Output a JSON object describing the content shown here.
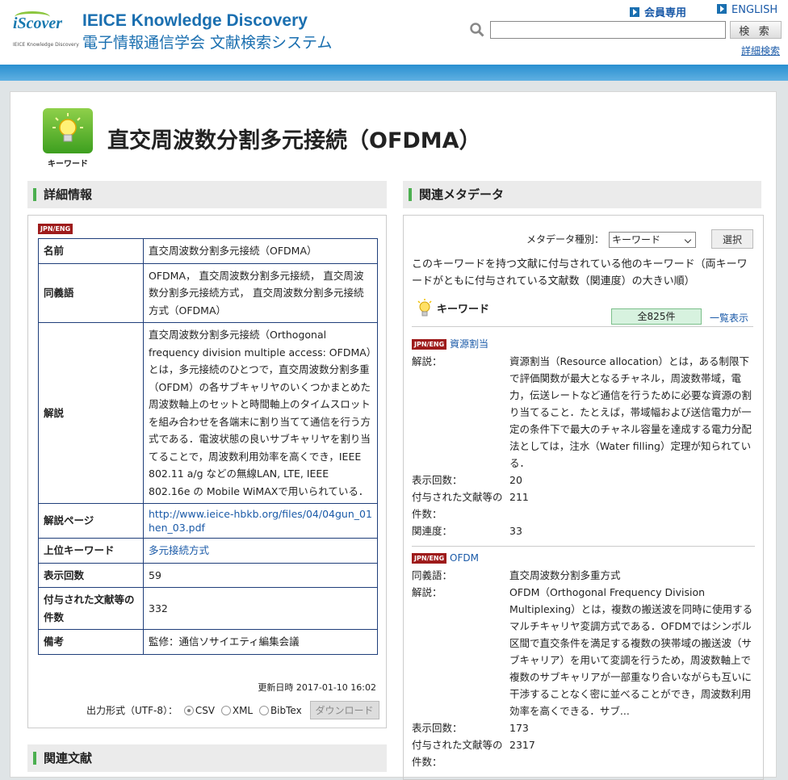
{
  "header": {
    "brand_title": "IEICE Knowledge Discovery",
    "brand_sub": "電子情報通信学会 文献検索システム",
    "logo_text": "iScover",
    "logo_sub": "IEICE Knowledge Discovery",
    "member_link": "会員専用",
    "english_link": "ENGLISH",
    "search_button": "検 索",
    "advanced_search": "詳細検索"
  },
  "page": {
    "icon_caption": "キーワード",
    "title": "直交周波数分割多元接続（OFDMA）"
  },
  "detail": {
    "heading": "詳細情報",
    "badge": "JPN/ENG",
    "rows": [
      {
        "k": "名前",
        "v": "直交周波数分割多元接続（OFDMA）"
      },
      {
        "k": "同義語",
        "v": "OFDMA， 直交周波数分割多元接続， 直交周波数分割多元接続方式， 直交周波数分割多元接続方式（OFDMA）"
      },
      {
        "k": "解説",
        "v": "直交周波数分割多元接続（Orthogonal frequency division multiple access: OFDMA）とは，多元接続のひとつで，直交周波数分割多重（OFDM）の各サブキャリヤのいくつかまとめた周波数軸上のセットと時間軸上のタイムスロットを組み合わせを各端末に割り当てて通信を行う方式である．電波状態の良いサブキャリヤを割り当てることで，周波数利用効率を高くでき，IEEE 802.11 a/g などの無線LAN, LTE, IEEE 802.16e の Mobile WiMAXで用いられている．"
      },
      {
        "k": "解説ページ",
        "v": "http://www.ieice-hbkb.org/files/04/04gun_01hen_03.pdf",
        "link": true
      },
      {
        "k": "上位キーワード",
        "v": "多元接続方式",
        "link": true
      },
      {
        "k": "表示回数",
        "v": "59"
      },
      {
        "k": "付与された文献等の件数",
        "v": "332"
      },
      {
        "k": "備考",
        "v": "監修：通信ソサイエティ編集会議"
      }
    ],
    "updated": "更新日時 2017-01-10 16:02",
    "format_label": "出力形式（UTF-8）：",
    "formats": [
      "CSV",
      "XML",
      "BibTex"
    ],
    "download": "ダウンロード"
  },
  "related_docs": {
    "heading": "関連文献"
  },
  "meta": {
    "heading": "関連メタデータ",
    "type_label": "メタデータ種別：",
    "type_value": "キーワード",
    "select_button": "選択",
    "description": "このキーワードを持つ文献に付与されている他のキーワード（両キーワードがともに付与されている文献数（関連度）の大きい順）",
    "kw_label": "キーワード",
    "count": "全825件",
    "list_all": "一覧表示",
    "entries": [
      {
        "badge": "JPN/ENG",
        "name": "資源割当",
        "rows": [
          {
            "k": "解説：",
            "v": "資源割当（Resource allocation）とは，ある制限下で評価関数が最大となるチャネル，周波数帯域，電力，伝送レートなど通信を行うために必要な資源の割り当てること．たとえば，帯域幅および送信電力が一定の条件下で最大のチャネル容量を達成する電力分配法としては，注水（Water filling）定理が知られている．"
          },
          {
            "k": "表示回数：",
            "v": "20"
          },
          {
            "k": "付与された文献等の件数：",
            "v": "211"
          },
          {
            "k": "関連度：",
            "v": "33"
          }
        ]
      },
      {
        "badge": "JPN/ENG",
        "name": "OFDM",
        "rows": [
          {
            "k": "同義語：",
            "v": "直交周波数分割多重方式"
          },
          {
            "k": "解説：",
            "v": "OFDM（Orthogonal Frequency Division Multiplexing）とは，複数の搬送波を同時に使用するマルチキャリヤ変調方式である．OFDMではシンボル区間で直交条件を満足する複数の狭帯域の搬送波（サブキャリア）を用いて変調を行うため，周波数軸上で複数のサブキャリアが一部重なり合いながらも互いに干渉することなく密に並べることができ，周波数利用効率を高くできる．サブ..."
          },
          {
            "k": "表示回数：",
            "v": "173"
          },
          {
            "k": "付与された文献等の件数：",
            "v": "2317"
          }
        ]
      }
    ]
  }
}
